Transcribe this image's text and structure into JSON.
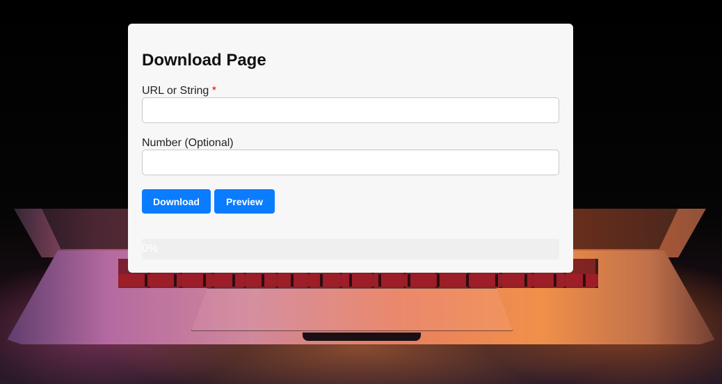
{
  "page": {
    "title": "Download Page"
  },
  "form": {
    "url_label": "URL or String",
    "url_required_mark": "*",
    "url_value": "",
    "url_placeholder": "",
    "number_label": "Number (Optional)",
    "number_value": "",
    "number_placeholder": ""
  },
  "buttons": {
    "download_label": "Download",
    "preview_label": "Preview"
  },
  "progress": {
    "value": 0,
    "text": "0%"
  },
  "colors": {
    "accent": "#0a7cff",
    "required": "#e00000",
    "card_background": "#f7f7f7"
  }
}
